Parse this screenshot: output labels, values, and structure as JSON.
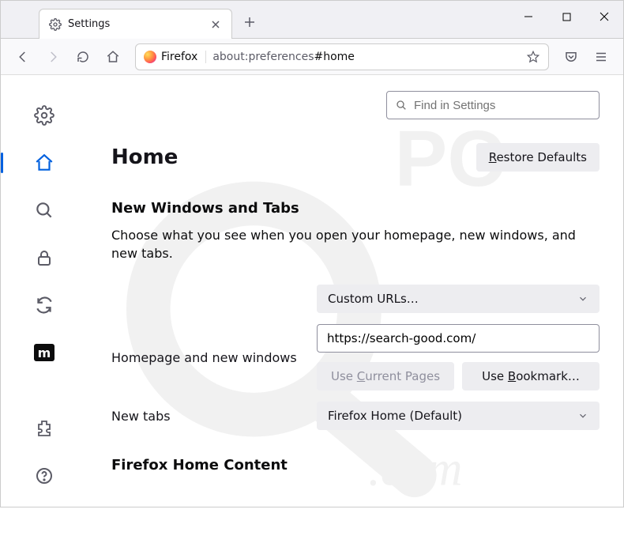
{
  "tab": {
    "title": "Settings"
  },
  "urlbar": {
    "identity": "Firefox",
    "url_prefix": "about:preferences",
    "url_path": "#home"
  },
  "search": {
    "placeholder": "Find in Settings"
  },
  "page": {
    "title": "Home",
    "restore_label": "Restore Defaults",
    "restore_ul": "R"
  },
  "section1": {
    "title": "New Windows and Tabs",
    "sub": "Choose what you see when you open your homepage, new windows, and new tabs."
  },
  "homepage": {
    "label": "Homepage and new windows",
    "select": "Custom URLs…",
    "url_value": "https://search-good.com/",
    "use_current": "Use Current Pages",
    "use_current_ul": "C",
    "use_bookmark": "Use Bookmark…",
    "use_bookmark_ul": "B"
  },
  "newtabs": {
    "label": "New tabs",
    "select": "Firefox Home (Default)"
  },
  "section2": {
    "title": "Firefox Home Content"
  }
}
